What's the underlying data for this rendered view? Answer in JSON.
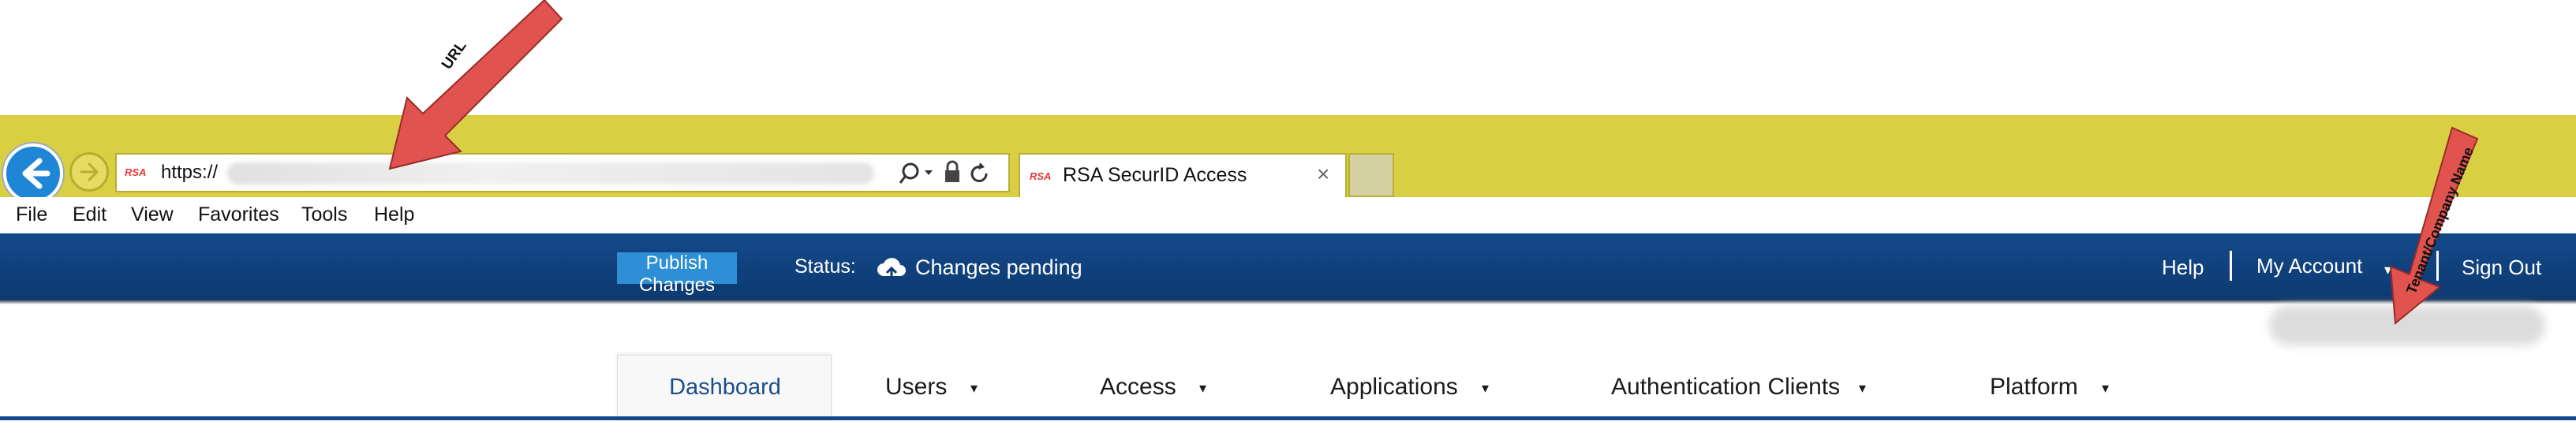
{
  "browser": {
    "address": {
      "visible_text": "https://",
      "brand_badge": "RSA"
    },
    "tab": {
      "title": "RSA SecurID Access",
      "brand_badge": "RSA",
      "close_glyph": "×"
    },
    "menu": [
      "File",
      "Edit",
      "View",
      "Favorites",
      "Tools",
      "Help"
    ],
    "colors": {
      "chrome": "#d9cf43",
      "back_button": "#1f86d6"
    }
  },
  "header": {
    "publish_label": "Publish Changes",
    "status_label": "Status:",
    "status_value": "Changes pending",
    "status_icon": "cloud-upload-icon",
    "help_label": "Help",
    "account_label": "My Account",
    "signout_label": "Sign Out",
    "colors": {
      "bar": "#0d3a70",
      "publish_button": "#2d8fd5"
    }
  },
  "nav": {
    "tabs": [
      {
        "label": "Dashboard",
        "active": true,
        "dropdown": false
      },
      {
        "label": "Users",
        "active": false,
        "dropdown": true
      },
      {
        "label": "Access",
        "active": false,
        "dropdown": true
      },
      {
        "label": "Applications",
        "active": false,
        "dropdown": true
      },
      {
        "label": "Authentication Clients",
        "active": false,
        "dropdown": true
      },
      {
        "label": "Platform",
        "active": false,
        "dropdown": true
      }
    ],
    "caret_glyph": "▾"
  },
  "annotations": {
    "url_label": "URL",
    "tenant_label": "Tenant/Company Name",
    "arrow_color": "#e0534f"
  }
}
